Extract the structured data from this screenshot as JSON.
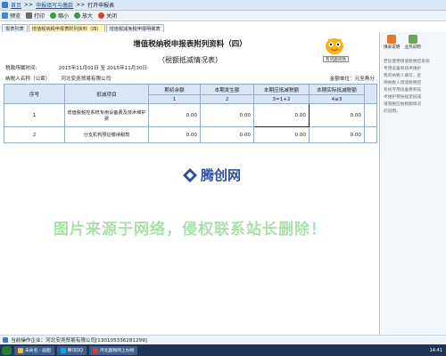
{
  "navbar": {
    "home": "首页",
    "sep": ">>",
    "crumb1": "申报填写与缴款",
    "crumb2": "打开申报表"
  },
  "toolbar": {
    "preview": "预览",
    "print": "打印",
    "zoom_out": "缩小",
    "zoom_in": "放大",
    "close": "关闭"
  },
  "tabs": [
    {
      "label": "报表列表"
    },
    {
      "label": "增值税纳税申报表附列资料（四）"
    },
    {
      "label": "增值税减免税申报明细表"
    }
  ],
  "form": {
    "title": "增值税纳税申报表附列资料（四）",
    "subtitle": "（税额抵减情况表）",
    "help_pill": "有问题问我",
    "period_label": "税款所属时间:",
    "period_value": "2015年11月01日 至 2015年11月30日",
    "taxpayer_label": "纳税人名称（公章）",
    "taxpayer_value": "河北安尧贸易有限公司",
    "unit": "金额单位：元至角分",
    "columns": [
      "序号",
      "抵减项目",
      "期初余额",
      "本期发生额",
      "本期应抵减税额",
      "本期实际抵减税额"
    ],
    "col_index": [
      "1",
      "2",
      "3=1+2",
      "4≤3"
    ],
    "rows": [
      {
        "seq": "1",
        "item": "增值税税控系统专用设备费及技术维护费",
        "values": [
          "0.00",
          "0.00",
          "0.00",
          "0.00"
        ]
      },
      {
        "seq": "2",
        "item": "分支机构预征缴纳税款",
        "values": [
          "0.00",
          "0.00",
          "0.00",
          "0.00"
        ]
      }
    ]
  },
  "watermark": {
    "logo": "腾创网",
    "note": "图片来源于网络，侵权联系站长删除！"
  },
  "side": {
    "tabs": [
      "填表说明",
      "业务说明"
    ],
    "text": "若您使用增值税税控系统\n专用设备和技术维护\n费的纳税人填写，反\n映纳税人增值税税控\n系统专用设备费和技\n术维护费按规定抵减\n增值税应纳税额情况\n的说明。",
    "colors": {
      "tab1": "#e8782e",
      "tab2": "#6aa84f"
    }
  },
  "status": {
    "text": "当前操作企业：河北安尧贸易有限公司[130105336281299]"
  },
  "taskbar": {
    "items": [
      "未命名 - 画图",
      "腾讯QQ",
      "河北国税网上办税"
    ],
    "clock": "14:41"
  }
}
